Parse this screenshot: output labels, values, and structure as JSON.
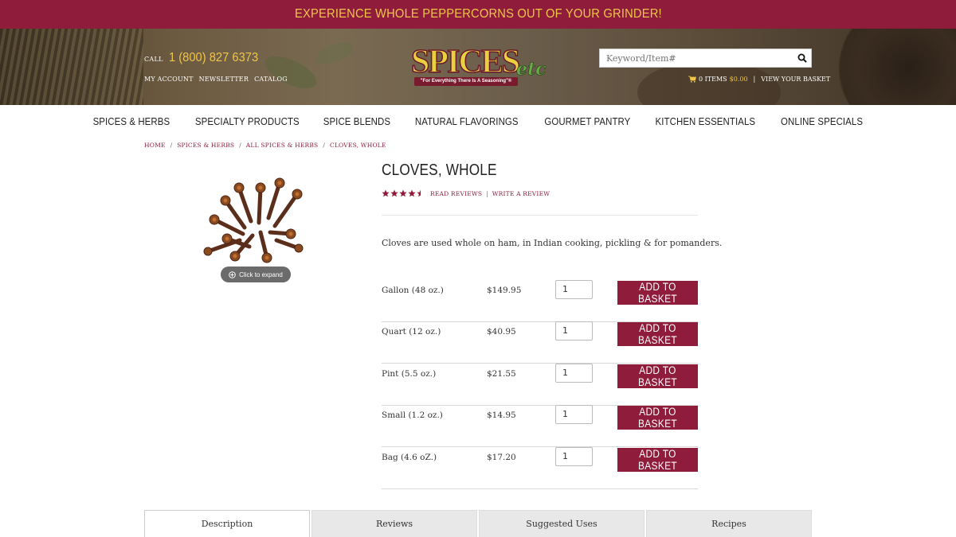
{
  "promo": {
    "text": "EXPERIENCE WHOLE PEPPERCORNS OUT OF YOUR GRINDER!"
  },
  "header": {
    "call_label": "CALL",
    "phone": "1 (800) 827 6373",
    "links": [
      "MY ACCOUNT",
      "NEWSLETTER",
      "CATALOG"
    ],
    "logo_word": "SPICES",
    "logo_etc": "etc",
    "logo_tagline": "\"For Everything There Is A Seasoning\"®",
    "search_placeholder": "Keyword/Item#",
    "cart_items": "0 ITEMS",
    "cart_total": "$0.00",
    "cart_sep": "|",
    "view_basket": "VIEW YOUR BASKET"
  },
  "nav": [
    "SPICES & HERBS",
    "SPECIALTY PRODUCTS",
    "SPICE BLENDS",
    "NATURAL FLAVORINGS",
    "GOURMET PANTRY",
    "KITCHEN ESSENTIALS",
    "ONLINE SPECIALS"
  ],
  "breadcrumb": [
    "HOME",
    "SPICES & HERBS",
    "ALL SPICES & HERBS",
    "CLOVES, WHOLE"
  ],
  "breadcrumb_sep": "/",
  "product": {
    "title": "CLOVES, WHOLE",
    "rating": 4.5,
    "read_reviews": "READ REVIEWS",
    "review_sep": "|",
    "write_review": "WRITE A REVIEW",
    "image_expand": "Click to expand",
    "description": "Cloves are used whole on ham, in Indian cooking, pickling & for pomanders."
  },
  "variants": [
    {
      "size": "Gallon (48 oz.)",
      "price": "$149.95",
      "qty": "1",
      "button": "ADD TO BASKET"
    },
    {
      "size": "Quart (12 oz.)",
      "price": "$40.95",
      "qty": "1",
      "button": "ADD TO BASKET"
    },
    {
      "size": "Pint (5.5 oz.)",
      "price": "$21.55",
      "qty": "1",
      "button": "ADD TO BASKET"
    },
    {
      "size": "Small (1.2 oz.)",
      "price": "$14.95",
      "qty": "1",
      "button": "ADD TO BASKET"
    },
    {
      "size": "Bag (4.6 oZ.)",
      "price": "$17.20",
      "qty": "1",
      "button": "ADD TO BASKET"
    }
  ],
  "tabs": [
    "Description",
    "Reviews",
    "Suggested Uses",
    "Recipes"
  ],
  "colors": {
    "brand": "#8e1c3a",
    "accent": "#f0c54a"
  },
  "icons": {
    "search": "search-icon",
    "cart": "cart-icon",
    "expand": "expand-icon",
    "star": "star-icon"
  }
}
